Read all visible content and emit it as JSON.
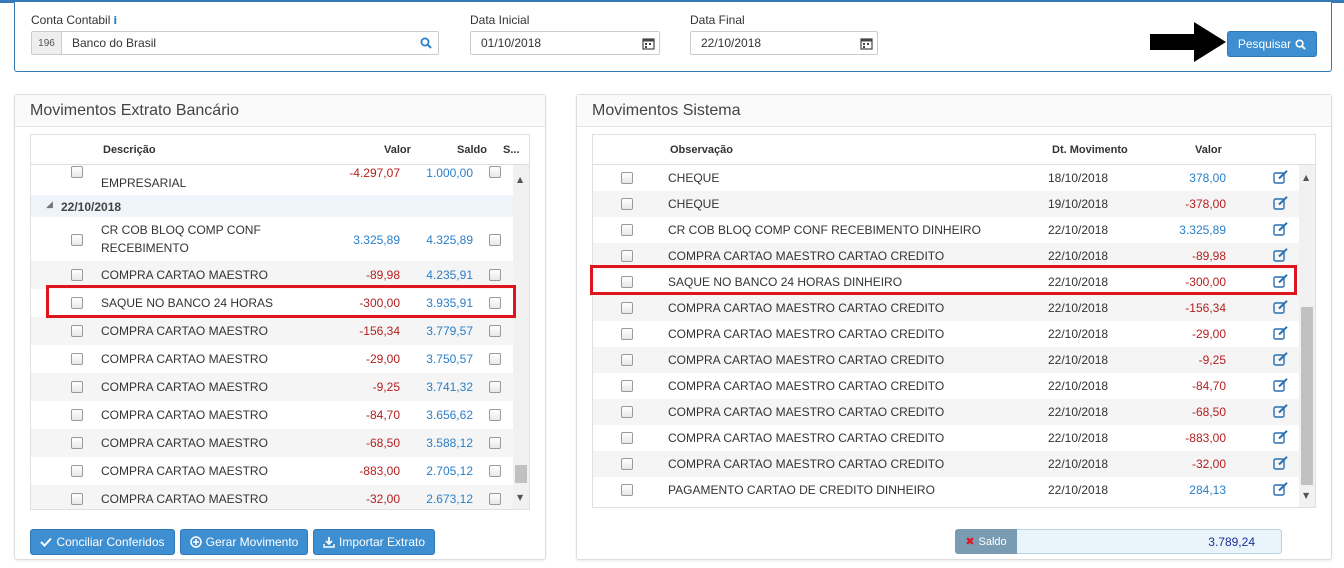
{
  "filter": {
    "conta_label": "Conta Contabil",
    "conta_code": "196",
    "conta_value": "Banco do Brasil",
    "data_inicial_label": "Data Inicial",
    "data_inicial_value": "01/10/2018",
    "data_final_label": "Data Final",
    "data_final_value": "22/10/2018",
    "search_button": "Pesquisar"
  },
  "extrato": {
    "title": "Movimentos Extrato Bancário",
    "headers": {
      "descricao": "Descrição",
      "valor": "Valor",
      "saldo": "Saldo",
      "s": "S..."
    },
    "partial_row": {
      "descricao": "EMPRESARIAL",
      "valor": "-4.297,07",
      "saldo": "1.000,00"
    },
    "group_label": "22/10/2018",
    "rows": [
      {
        "descricao_1": "CR COB BLOQ COMP CONF",
        "descricao_2": "RECEBIMENTO",
        "valor": "3.325,89",
        "saldo": "4.325,89"
      },
      {
        "descricao_1": "COMPRA CARTAO MAESTRO",
        "valor": "-89,98",
        "saldo": "4.235,91"
      },
      {
        "descricao_1": "SAQUE NO BANCO 24 HORAS",
        "valor": "-300,00",
        "saldo": "3.935,91"
      },
      {
        "descricao_1": "COMPRA CARTAO MAESTRO",
        "valor": "-156,34",
        "saldo": "3.779,57"
      },
      {
        "descricao_1": "COMPRA CARTAO MAESTRO",
        "valor": "-29,00",
        "saldo": "3.750,57"
      },
      {
        "descricao_1": "COMPRA CARTAO MAESTRO",
        "valor": "-9,25",
        "saldo": "3.741,32"
      },
      {
        "descricao_1": "COMPRA CARTAO MAESTRO",
        "valor": "-84,70",
        "saldo": "3.656,62"
      },
      {
        "descricao_1": "COMPRA CARTAO MAESTRO",
        "valor": "-68,50",
        "saldo": "3.588,12"
      },
      {
        "descricao_1": "COMPRA CARTAO MAESTRO",
        "valor": "-883,00",
        "saldo": "2.705,12"
      },
      {
        "descricao_1": "COMPRA CARTAO MAESTRO",
        "valor": "-32,00",
        "saldo": "2.673,12"
      }
    ],
    "buttons": {
      "conciliar": "Conciliar Conferidos",
      "gerar": "Gerar Movimento",
      "importar": "Importar Extrato"
    }
  },
  "sistema": {
    "title": "Movimentos Sistema",
    "headers": {
      "observacao": "Observação",
      "dt": "Dt. Movimento",
      "valor": "Valor"
    },
    "rows": [
      {
        "obs": "CHEQUE",
        "dt": "18/10/2018",
        "valor": "378,00"
      },
      {
        "obs": "CHEQUE",
        "dt": "19/10/2018",
        "valor": "-378,00"
      },
      {
        "obs": "CR COB BLOQ COMP CONF RECEBIMENTO DINHEIRO",
        "dt": "22/10/2018",
        "valor": "3.325,89"
      },
      {
        "obs": "COMPRA CARTAO MAESTRO CARTAO CREDITO",
        "dt": "22/10/2018",
        "valor": "-89,98"
      },
      {
        "obs": "SAQUE NO BANCO 24 HORAS DINHEIRO",
        "dt": "22/10/2018",
        "valor": "-300,00"
      },
      {
        "obs": "COMPRA CARTAO MAESTRO CARTAO CREDITO",
        "dt": "22/10/2018",
        "valor": "-156,34"
      },
      {
        "obs": "COMPRA CARTAO MAESTRO CARTAO CREDITO",
        "dt": "22/10/2018",
        "valor": "-29,00"
      },
      {
        "obs": "COMPRA CARTAO MAESTRO CARTAO CREDITO",
        "dt": "22/10/2018",
        "valor": "-9,25"
      },
      {
        "obs": "COMPRA CARTAO MAESTRO CARTAO CREDITO",
        "dt": "22/10/2018",
        "valor": "-84,70"
      },
      {
        "obs": "COMPRA CARTAO MAESTRO CARTAO CREDITO",
        "dt": "22/10/2018",
        "valor": "-68,50"
      },
      {
        "obs": "COMPRA CARTAO MAESTRO CARTAO CREDITO",
        "dt": "22/10/2018",
        "valor": "-883,00"
      },
      {
        "obs": "COMPRA CARTAO MAESTRO CARTAO CREDITO",
        "dt": "22/10/2018",
        "valor": "-32,00"
      },
      {
        "obs": "PAGAMENTO CARTAO DE CREDITO DINHEIRO",
        "dt": "22/10/2018",
        "valor": "284,13"
      }
    ],
    "saldo_label": "Saldo",
    "saldo_value": "3.789,24"
  },
  "colors": {
    "primary": "#3d8fd1",
    "negative": "#b52020",
    "positive": "#2a7fc9",
    "highlight": "#e0141e"
  }
}
